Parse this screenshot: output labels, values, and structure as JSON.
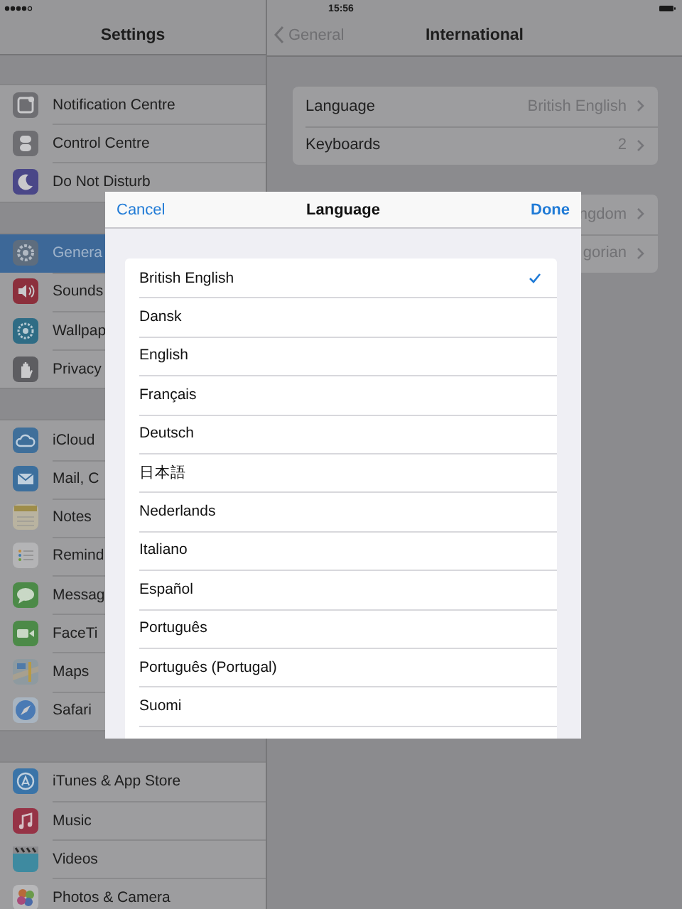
{
  "status_bar": {
    "time": "15:56"
  },
  "sidebar": {
    "title": "Settings",
    "groups": [
      [
        {
          "label": "Notification Centre",
          "selected": false
        },
        {
          "label": "Control Centre",
          "selected": false
        },
        {
          "label": "Do Not Disturb",
          "selected": false
        }
      ],
      [
        {
          "label": "Genera",
          "selected": true
        },
        {
          "label": "Sounds",
          "selected": false
        },
        {
          "label": "Wallpap",
          "selected": false
        },
        {
          "label": "Privacy",
          "selected": false
        }
      ],
      [
        {
          "label": "iCloud",
          "selected": false
        },
        {
          "label": "Mail, C",
          "selected": false
        },
        {
          "label": "Notes",
          "selected": false
        },
        {
          "label": "Remind",
          "selected": false
        },
        {
          "label": "Messag",
          "selected": false
        },
        {
          "label": "FaceTi",
          "selected": false
        },
        {
          "label": "Maps",
          "selected": false
        },
        {
          "label": "Safari",
          "selected": false
        }
      ],
      [
        {
          "label": "iTunes & App Store",
          "selected": false
        },
        {
          "label": "Music",
          "selected": false
        },
        {
          "label": "Videos",
          "selected": false
        },
        {
          "label": "Photos & Camera",
          "selected": false
        }
      ]
    ]
  },
  "detail": {
    "back": "General",
    "title": "International",
    "groups": [
      [
        {
          "label": "Language",
          "value": "British English"
        },
        {
          "label": "Keyboards",
          "value": "2"
        }
      ],
      [
        {
          "value": "ngdom"
        },
        {
          "value": "gorian"
        }
      ]
    ]
  },
  "popup": {
    "cancel": "Cancel",
    "title": "Language",
    "done": "Done",
    "languages": [
      {
        "label": "British English",
        "selected": true
      },
      {
        "label": "Dansk",
        "selected": false
      },
      {
        "label": "English",
        "selected": false
      },
      {
        "label": "Français",
        "selected": false
      },
      {
        "label": "Deutsch",
        "selected": false
      },
      {
        "label": "日本語",
        "selected": false
      },
      {
        "label": "Nederlands",
        "selected": false
      },
      {
        "label": "Italiano",
        "selected": false
      },
      {
        "label": "Español",
        "selected": false
      },
      {
        "label": "Português",
        "selected": false
      },
      {
        "label": "Português (Portugal)",
        "selected": false
      },
      {
        "label": "Suomi",
        "selected": false
      }
    ]
  }
}
